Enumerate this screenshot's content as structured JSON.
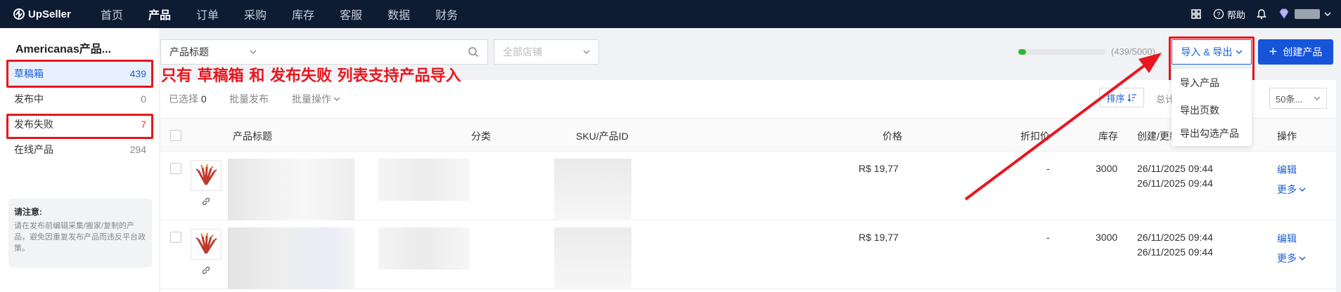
{
  "app": {
    "name": "UpSeller"
  },
  "nav": {
    "items": [
      "首页",
      "产品",
      "订单",
      "采购",
      "库存",
      "客服",
      "数据",
      "财务"
    ],
    "active_index": 1
  },
  "topbar": {
    "help_label": "帮助"
  },
  "sidebar": {
    "store_title": "Americanas产品...",
    "items": [
      {
        "label": "草稿箱",
        "count": "439"
      },
      {
        "label": "发布中",
        "count": "0"
      },
      {
        "label": "发布失败",
        "count": "7"
      },
      {
        "label": "在线产品",
        "count": "294"
      }
    ],
    "notice_title": "请注意:",
    "notice_text": "请在发布前编辑采集/搬家/复制的产品，避免因重复发布产品而违反平台政策。"
  },
  "annotation": "只有 草稿箱 和 发布失败 列表支持产品导入",
  "filters": {
    "field_select": "产品标题",
    "store_select_placeholder": "全部店铺"
  },
  "quota": {
    "text": "(439/5000)",
    "fraction": 0.0878
  },
  "buttons": {
    "import_export": "导入 & 导出",
    "create": "创建产品"
  },
  "dropdown": {
    "items": [
      "导入产品",
      "导出页数",
      "导出勾选产品"
    ]
  },
  "toolbar": {
    "selected_label": "已选择",
    "selected_count": "0",
    "batch_publish": "批量发布",
    "batch_ops": "批量操作",
    "sort": "排序",
    "total_prefix": "总计",
    "page_size": "50条..."
  },
  "table": {
    "headers": [
      "产品标题",
      "分类",
      "SKU/产品ID",
      "价格",
      "折扣价",
      "库存",
      "创建/更新时间",
      "操作"
    ],
    "rows": [
      {
        "price": "R$ 19,77",
        "discount": "-",
        "stock": "3000",
        "created": "26/11/2025 09:44",
        "updated": "26/11/2025 09:44",
        "edit": "编辑",
        "more": "更多"
      },
      {
        "price": "R$ 19,77",
        "discount": "-",
        "stock": "3000",
        "created": "26/11/2025 09:44",
        "updated": "26/11/2025 09:44",
        "edit": "编辑",
        "more": "更多"
      }
    ]
  },
  "colors": {
    "accent": "#1654d9",
    "nav_bg": "#0d1b33",
    "annotation_red": "#e8161e"
  }
}
